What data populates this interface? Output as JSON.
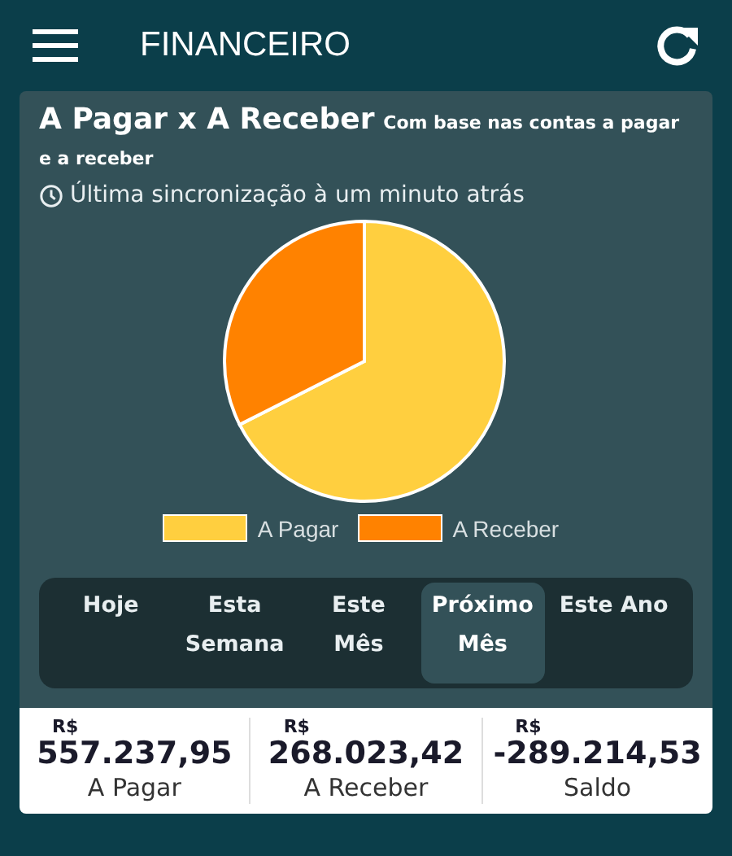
{
  "header": {
    "title": "FINANCEIRO"
  },
  "card": {
    "title": "A Pagar x A Receber",
    "subtitle": "Com base nas contas a pagar e a receber",
    "sync": "Última sincronização à um minuto atrás",
    "chart_data": {
      "type": "pie",
      "categories": [
        "A Pagar",
        "A Receber"
      ],
      "series": [
        {
          "values": [
            67.52,
            32.48
          ]
        }
      ],
      "colors": [
        "#ffcf3f",
        "#ff8200"
      ],
      "legend": "bottom"
    },
    "periods": [
      {
        "label": "Hoje",
        "selected": false
      },
      {
        "label": "Esta Semana",
        "selected": false
      },
      {
        "label": "Este Mês",
        "selected": false
      },
      {
        "label": "Próximo Mês",
        "selected": true
      },
      {
        "label": "Este Ano",
        "selected": false
      }
    ]
  },
  "summary": [
    {
      "currency": "R$",
      "amount": "557.237,95",
      "label": "A Pagar"
    },
    {
      "currency": "R$",
      "amount": "268.023,42",
      "label": "A Receber"
    },
    {
      "currency": "R$",
      "amount": "-289.214,53",
      "label": "Saldo"
    }
  ]
}
